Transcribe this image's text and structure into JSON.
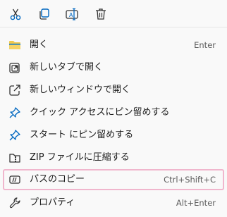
{
  "toolbar": {
    "buttons": [
      {
        "name": "cut",
        "icon": "scissors-icon"
      },
      {
        "name": "copy",
        "icon": "copy-icon"
      },
      {
        "name": "rename",
        "icon": "rename-icon"
      },
      {
        "name": "delete",
        "icon": "trash-icon"
      }
    ]
  },
  "menu": {
    "items": [
      {
        "label": "開く",
        "shortcut": "Enter",
        "icon": "folder-icon"
      },
      {
        "label": "新しいタブで開く",
        "shortcut": "",
        "icon": "open-in-new-tab-icon"
      },
      {
        "label": "新しいウィンドウで開く",
        "shortcut": "",
        "icon": "open-in-new-window-icon"
      },
      {
        "label": "クイック アクセスにピン留めする",
        "shortcut": "",
        "icon": "pin-icon"
      },
      {
        "label": "スタート にピン留めする",
        "shortcut": "",
        "icon": "pin-icon"
      },
      {
        "label": "ZIP ファイルに圧縮する",
        "shortcut": "",
        "icon": "zip-folder-icon"
      },
      {
        "label": "パスのコピー",
        "shortcut": "Ctrl+Shift+C",
        "icon": "copy-path-icon"
      },
      {
        "label": "プロパティ",
        "shortcut": "Alt+Enter",
        "icon": "wrench-icon"
      }
    ]
  },
  "colors": {
    "highlight_border": "#f0b6cd",
    "accent": "#0067c0",
    "folder_yellow": "#f2c94c"
  }
}
